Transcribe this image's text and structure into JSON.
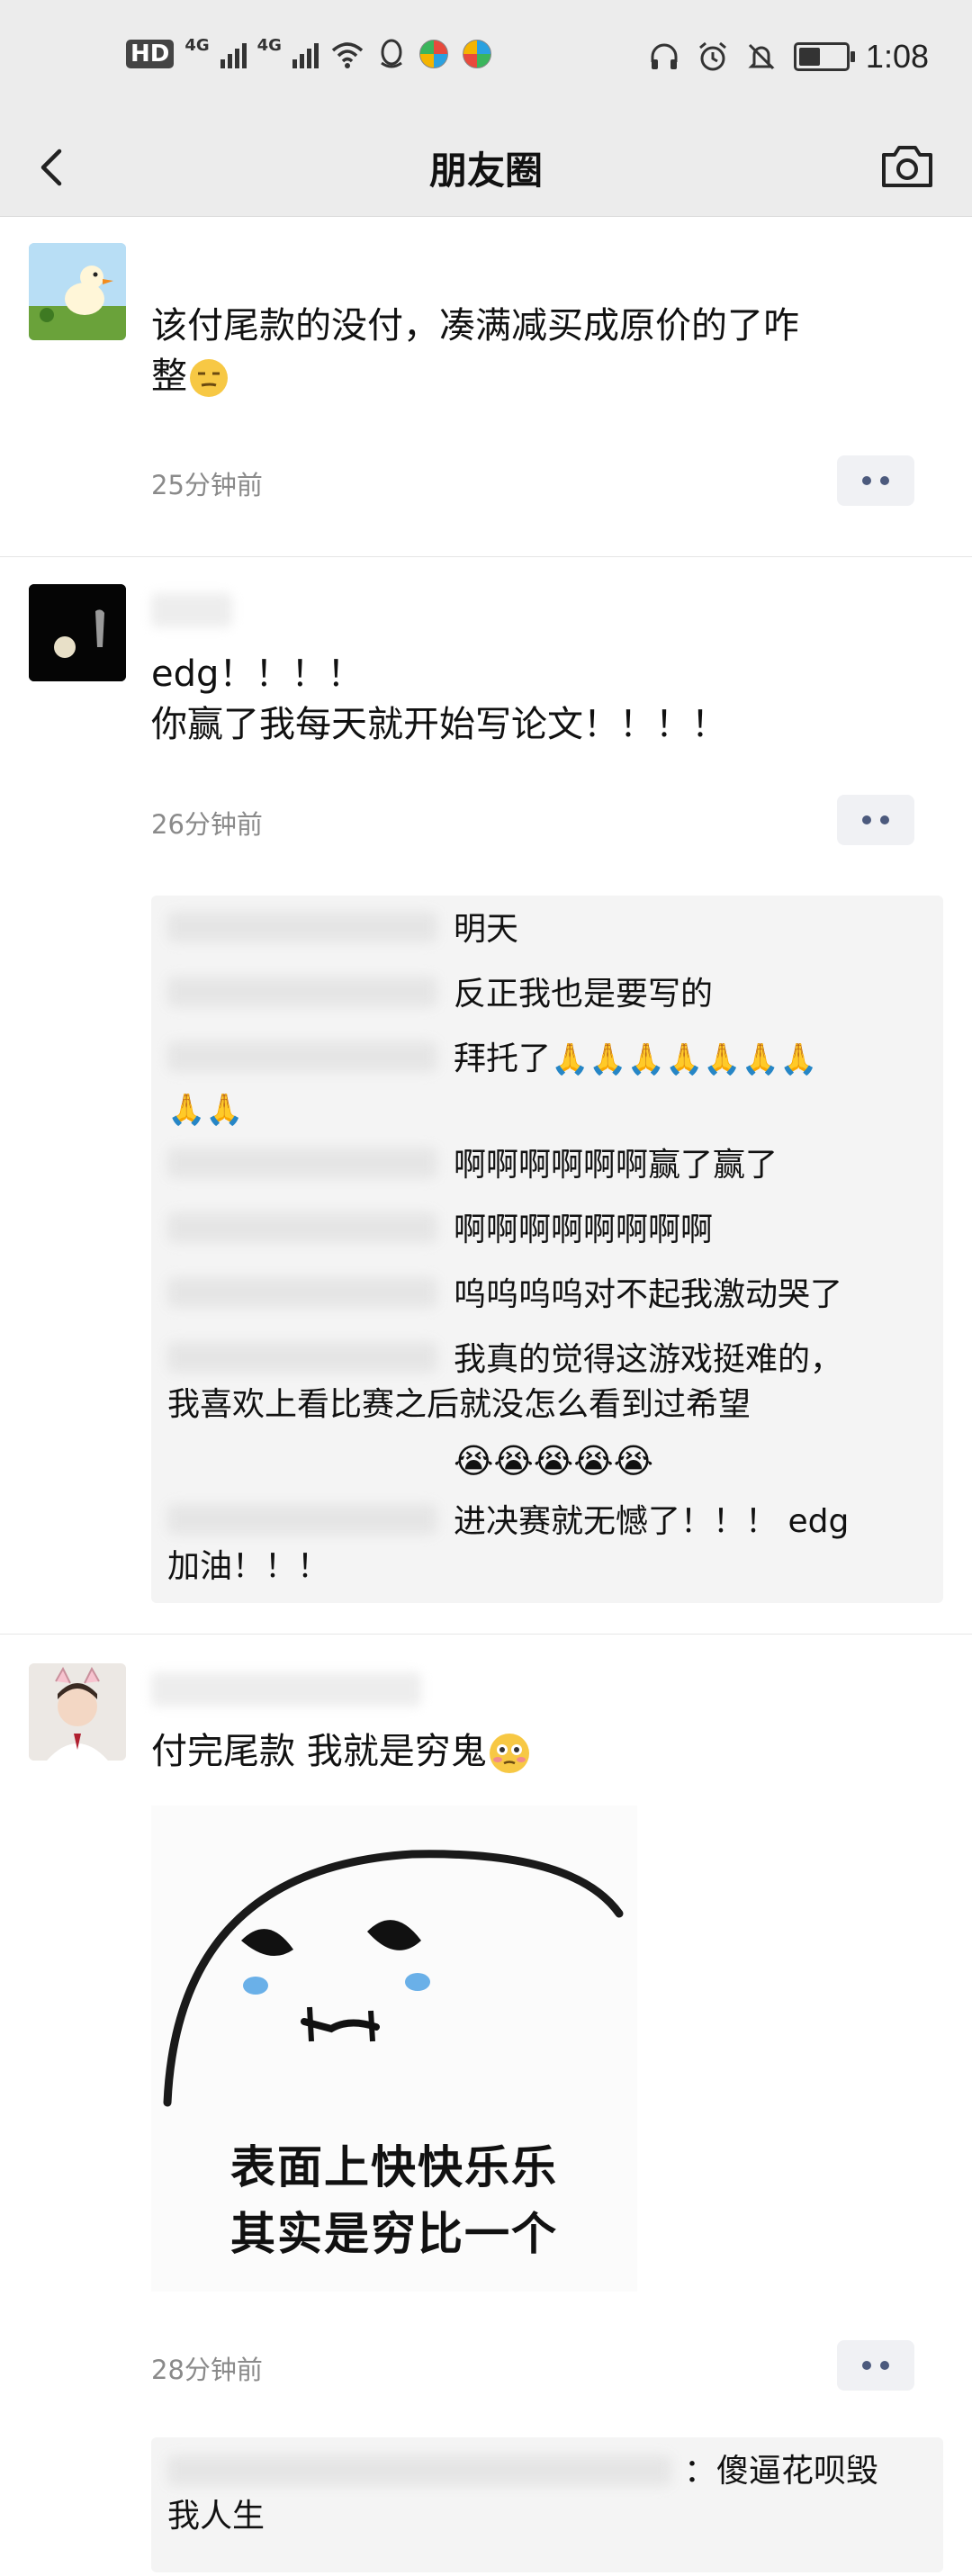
{
  "status_bar": {
    "hd_label": "HD",
    "net_1": "4G",
    "net_2": "4G",
    "time": "1:08",
    "battery_level": 0.45
  },
  "nav": {
    "title": "朋友圈"
  },
  "posts": [
    {
      "text": "该付尾款的没付，凑满减买成原价的了咋\n整",
      "time": "25分钟前"
    },
    {
      "text": "edg！！！！\n你赢了我每天就开始写论文！！！！",
      "time": "26分钟前",
      "comments": [
        "明天",
        "反正我也是要写的",
        "拜托了",
        "啊啊啊啊啊啊赢了赢了",
        "啊啊啊啊啊啊啊啊",
        "呜呜呜呜对不起我激动哭了",
        "我真的觉得这游戏挺难的，",
        "我喜欢上看比赛之后就没怎么看到过希望",
        "进决赛就无憾了！！！ edg",
        "加油！！！"
      ]
    },
    {
      "text": "付完尾款 我就是穷鬼",
      "image_text_1": "表面上快快乐乐",
      "image_text_2": "其实是穷比一个",
      "time": "28分钟前",
      "comments": [
        "：傻逼花呗毁",
        "我人生"
      ]
    }
  ],
  "colors": {
    "bar_bg": "#ececec",
    "link_dots": "#4c5a7d",
    "time_gray": "#8a8a8a",
    "comment_bg": "#f4f4f4"
  }
}
